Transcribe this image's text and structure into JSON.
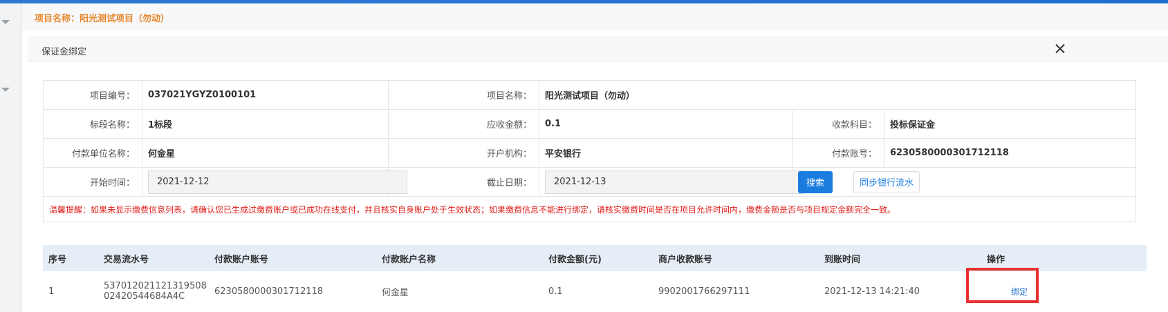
{
  "project_header": {
    "title": "项目名称：阳光测试项目（勿动）"
  },
  "dialog": {
    "title": "保证金绑定"
  },
  "form": {
    "rows": [
      [
        {
          "label": "项目编号：",
          "value": "037021YGYZ0100101"
        },
        {
          "label": "项目名称：",
          "value": "阳光测试项目（勿动）"
        }
      ],
      [
        {
          "label": "标段名称：",
          "value": "1标段"
        },
        {
          "label": "应收金额：",
          "value": "0.1"
        },
        {
          "label": "收款科目：",
          "value": "投标保证金"
        }
      ],
      [
        {
          "label": "付款单位名称：",
          "value": "何金星"
        },
        {
          "label": "开户机构：",
          "value": "平安银行"
        },
        {
          "label": "付款账号：",
          "value": "6230580000301712118"
        }
      ]
    ],
    "start_time_label": "开始时间：",
    "start_time_value": "2021-12-12",
    "end_date_label": "截止日期：",
    "end_date_value": "2021-12-13",
    "search_label": "搜索",
    "sync_label": "同步银行流水",
    "tip": "温馨提醒：如果未显示缴费信息列表，请确认您已生成过缴费账户或已成功在线支付，并且核实自身账户处于生效状态；如果缴费信息不能进行绑定，请核实缴费时间是否在项目允许时间内，缴费金额是否与项目规定金额完全一致。"
  },
  "table": {
    "columns": [
      "序号",
      "交易流水号",
      "付款账户账号",
      "付款账户名称",
      "付款金额(元)",
      "商户收款账号",
      "到账时间",
      "操作"
    ],
    "rows": [
      {
        "index": "1",
        "serial_line1": "537012021121319508",
        "serial_line2": "02420544684A4C",
        "pay_account": "6230580000301712118",
        "pay_name": "何金星",
        "amount": "0.1",
        "merchant_account": "9902001766297111",
        "arrival_time": "2021-12-13 14:21:40",
        "action": "绑定"
      }
    ]
  },
  "colors": {
    "primary": "#1b7ce0",
    "warning_text": "#e0201b",
    "project_title": "#e6862a",
    "highlight_border": "#e8322f",
    "table_header_bg": "#e5edf6"
  }
}
